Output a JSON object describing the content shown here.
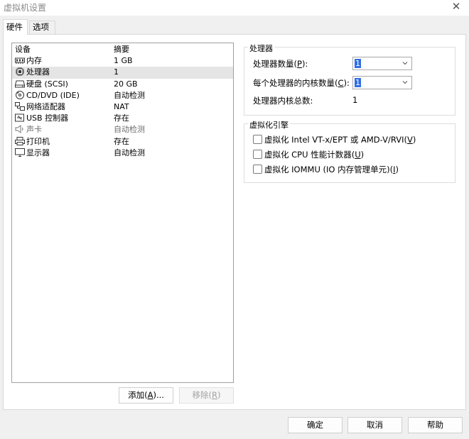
{
  "window": {
    "title": "虚拟机设置",
    "close_glyph": "✕"
  },
  "tabs": [
    {
      "label": "硬件",
      "active": true
    },
    {
      "label": "选项",
      "active": false
    }
  ],
  "device_list": {
    "columns": [
      "设备",
      "摘要"
    ],
    "rows": [
      {
        "icon": "memory-icon",
        "device": "内存",
        "summary": "1 GB",
        "selected": false,
        "disabled": false
      },
      {
        "icon": "cpu-icon",
        "device": "处理器",
        "summary": "1",
        "selected": true,
        "disabled": false
      },
      {
        "icon": "hard-disk-icon",
        "device": "硬盘 (SCSI)",
        "summary": "20 GB",
        "selected": false,
        "disabled": false
      },
      {
        "icon": "cd-dvd-icon",
        "device": "CD/DVD (IDE)",
        "summary": "自动检测",
        "selected": false,
        "disabled": false
      },
      {
        "icon": "network-adapter-icon",
        "device": "网络适配器",
        "summary": "NAT",
        "selected": false,
        "disabled": false
      },
      {
        "icon": "usb-icon",
        "device": "USB 控制器",
        "summary": "存在",
        "selected": false,
        "disabled": false
      },
      {
        "icon": "speaker-icon",
        "device": "声卡",
        "summary": "自动检测",
        "selected": false,
        "disabled": true
      },
      {
        "icon": "printer-icon",
        "device": "打印机",
        "summary": "存在",
        "selected": false,
        "disabled": false
      },
      {
        "icon": "monitor-icon",
        "device": "显示器",
        "summary": "自动检测",
        "selected": false,
        "disabled": false
      }
    ]
  },
  "list_buttons": {
    "add": {
      "text": "添加(",
      "key": "A",
      "tail": ")..."
    },
    "remove": {
      "text": "移除(",
      "key": "R",
      "tail": ")"
    }
  },
  "processor_group": {
    "title": "处理器",
    "count_label": {
      "text": "处理器数量(",
      "key": "P",
      "tail": "):"
    },
    "count_value": "1",
    "cores_label": {
      "text": "每个处理器的内核数量(",
      "key": "C",
      "tail": "):"
    },
    "cores_value": "1",
    "total_label": "处理器内核总数:",
    "total_value": "1"
  },
  "virtualization_group": {
    "title": "虚拟化引擎",
    "options": [
      {
        "text": "虚拟化 Intel VT-x/EPT 或 AMD-V/RVI(",
        "key": "V",
        "tail": ")",
        "checked": false
      },
      {
        "text": "虚拟化 CPU 性能计数器(",
        "key": "U",
        "tail": ")",
        "checked": false
      },
      {
        "text": "虚拟化 IOMMU (IO 内存管理单元)(",
        "key": "I",
        "tail": ")",
        "checked": false
      }
    ]
  },
  "footer": {
    "ok": "确定",
    "cancel": "取消",
    "help": "帮助"
  },
  "colors": {
    "selection_accent": "#2f6ee6",
    "selected_row": "#e5e5e5"
  }
}
